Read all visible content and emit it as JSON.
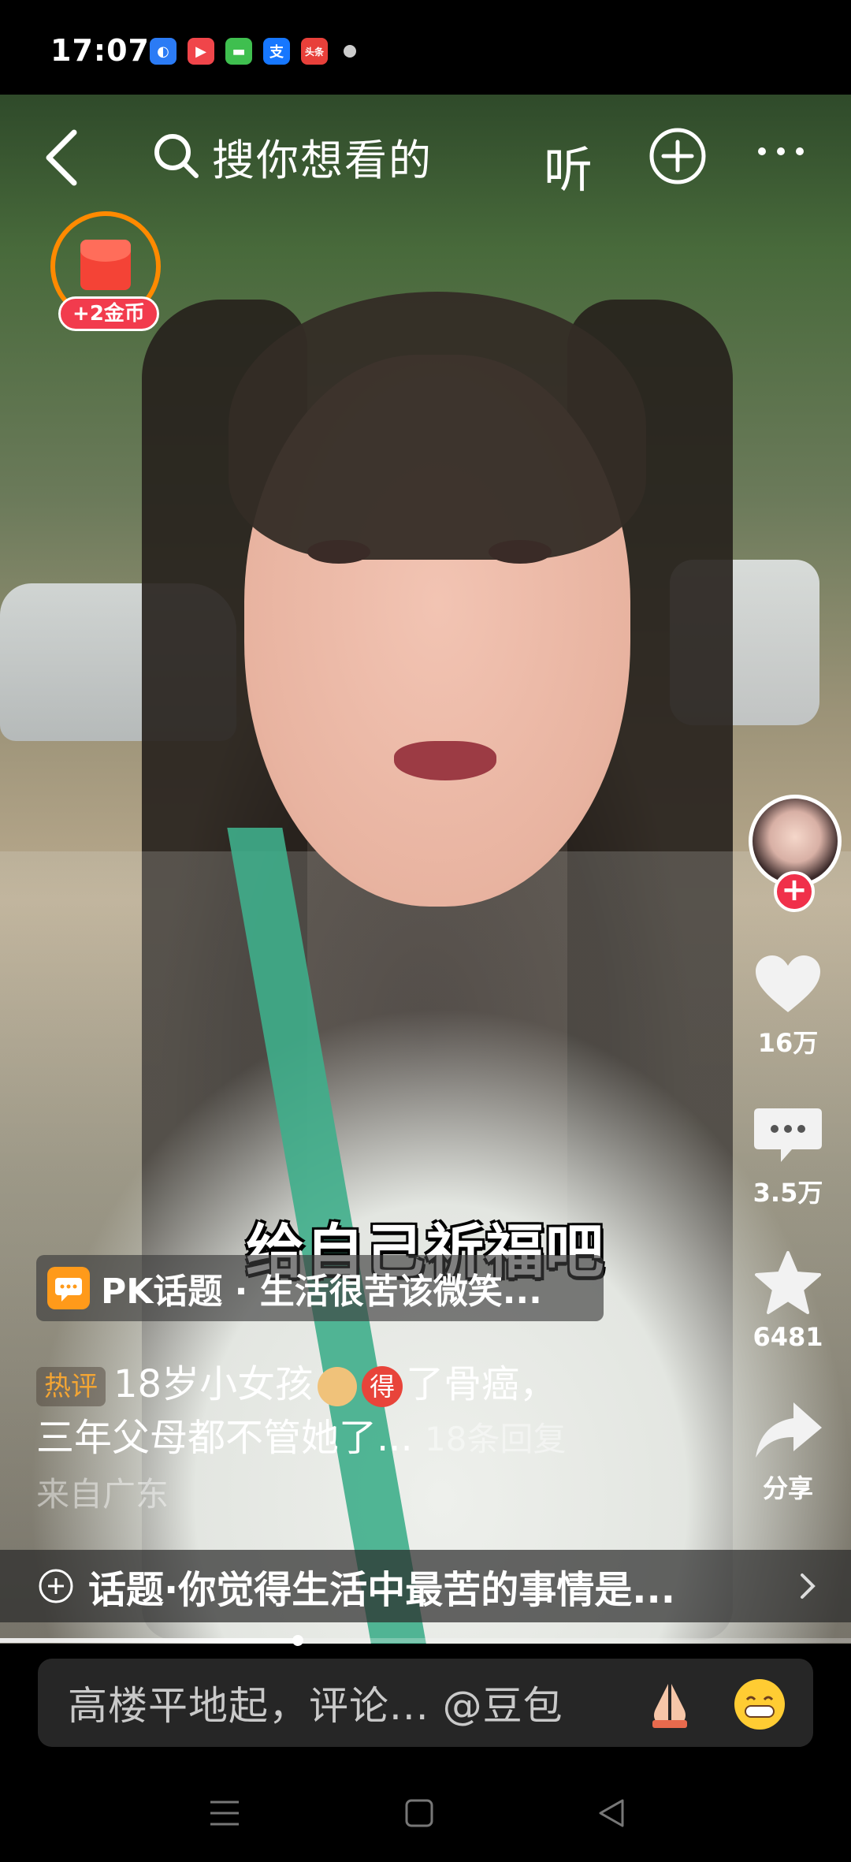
{
  "status_bar": {
    "time": "17:07",
    "app_icons": [
      {
        "name": "blue-app-icon",
        "color": "#2b7bf5",
        "glyph": "◐"
      },
      {
        "name": "video-app-icon",
        "color": "#f0454a",
        "glyph": "▶"
      },
      {
        "name": "message-app-icon",
        "color": "#3fbf4f",
        "glyph": "▬"
      },
      {
        "name": "alipay-icon",
        "color": "#1677ff",
        "glyph": "支"
      },
      {
        "name": "toutiao-icon",
        "color": "#e8403a",
        "glyph": "头条"
      }
    ]
  },
  "top_nav": {
    "search_placeholder": "搜你想看的",
    "listen_label": "听"
  },
  "coin_badge": {
    "label": "+2金币"
  },
  "right_rail": {
    "like_count": "16万",
    "comment_count": "3.5万",
    "favorite_count": "6481",
    "share_label": "分享"
  },
  "video": {
    "caption": "给自己祈福吧"
  },
  "pk_topic": {
    "text": "PK话题 · 生活很苦该微笑..."
  },
  "hot_comment": {
    "tag": "热评",
    "text_part1": "18岁小女孩",
    "emoji_de": "得",
    "text_part2": "了骨癌，",
    "line2": "三年父母都不管她了...",
    "replies": "18条回复",
    "location": "来自广东"
  },
  "topic_bar": {
    "text": "话题·你觉得生活中最苦的事情是..."
  },
  "playback": {
    "progress": 0.35
  },
  "comment_input": {
    "placeholder": "高楼平地起，评论... @豆包"
  },
  "colors": {
    "accent_red": "#f0304a",
    "coin_orange": "#ff8a00",
    "hot_tag": "#f3a534"
  }
}
